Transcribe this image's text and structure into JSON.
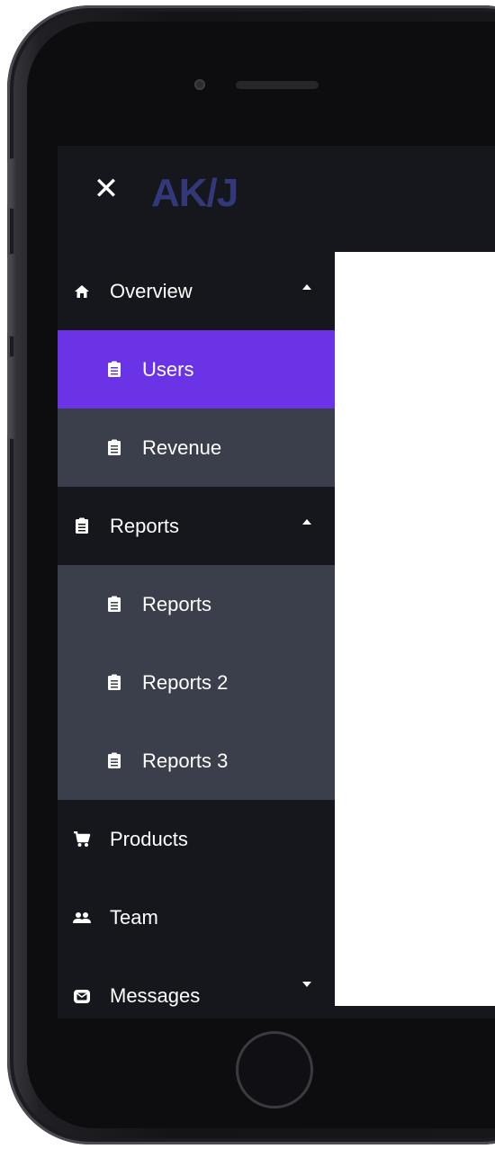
{
  "app": {
    "logo_text": "AK/J",
    "close_glyph": "✕"
  },
  "colors": {
    "sidebar_bg": "#16171c",
    "submenu_bg": "#3b3f4c",
    "active_bg": "#6a33e6",
    "logo": "#33387a",
    "text": "#ffffff"
  },
  "sidebar": {
    "overview": {
      "label": "Overview",
      "icon": "home-icon",
      "expanded": true,
      "children": [
        {
          "label": "Users",
          "icon": "clipboard-icon",
          "active": true
        },
        {
          "label": "Revenue",
          "icon": "clipboard-icon",
          "active": false
        }
      ]
    },
    "reports": {
      "label": "Reports",
      "icon": "clipboard-icon",
      "expanded": true,
      "children": [
        {
          "label": "Reports",
          "icon": "clipboard-icon"
        },
        {
          "label": "Reports 2",
          "icon": "clipboard-icon"
        },
        {
          "label": "Reports 3",
          "icon": "clipboard-icon"
        }
      ]
    },
    "products": {
      "label": "Products",
      "icon": "cart-icon"
    },
    "team": {
      "label": "Team",
      "icon": "people-icon"
    },
    "messages": {
      "label": "Messages",
      "icon": "envelope-icon",
      "expanded": false
    }
  }
}
